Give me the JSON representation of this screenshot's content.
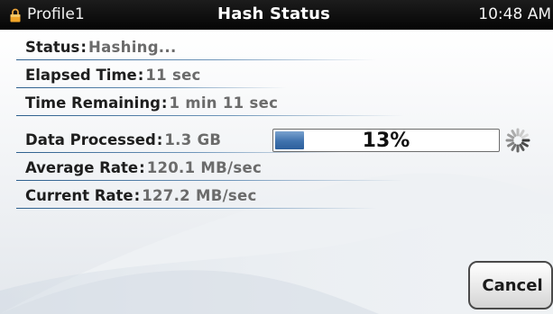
{
  "status_bar": {
    "profile": "Profile1",
    "title": "Hash Status",
    "time": "10:48 AM",
    "lock_icon": "lock-icon"
  },
  "rows": [
    {
      "label": "Status",
      "value": "Hashing..."
    },
    {
      "label": "Elapsed Time",
      "value": "11 sec"
    },
    {
      "label": "Time Remaining",
      "value": "1 min 11 sec"
    },
    {
      "label": "Data Processed",
      "value": "1.3 GB"
    },
    {
      "label": "Average Rate",
      "value": "120.1 MB/sec"
    },
    {
      "label": "Current Rate",
      "value": "127.2 MB/sec"
    }
  ],
  "progress": {
    "percent_text": "13%",
    "fraction": 0.13,
    "spinner_icon": "spinner-icon"
  },
  "buttons": {
    "cancel": "Cancel"
  },
  "colors": {
    "status_bar": "#0d0d0d",
    "accent_blue": "#3f72ad",
    "value_gray": "#6b6b6b"
  }
}
